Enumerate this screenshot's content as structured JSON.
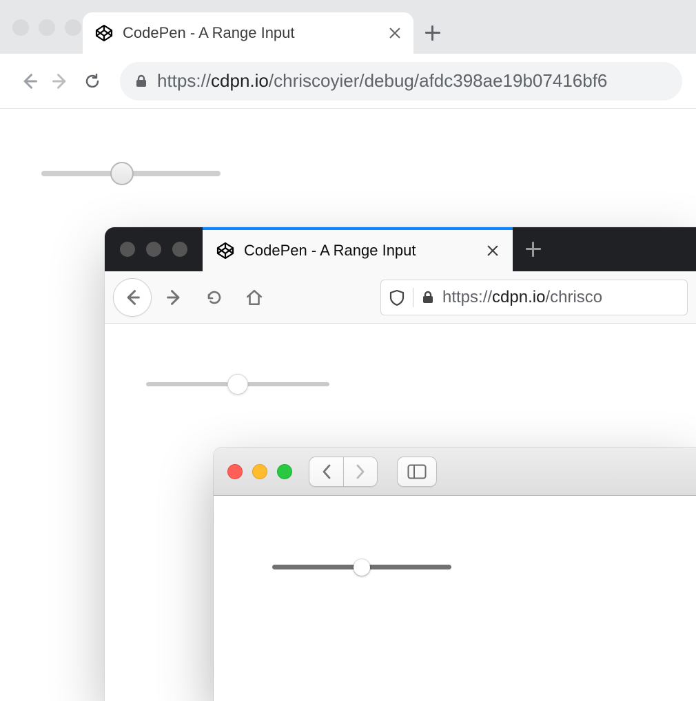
{
  "chrome": {
    "tab_title": "CodePen - A Range Input",
    "url_scheme": "https://",
    "url_host": "cdpn.io",
    "url_path": "/chriscoyier/debug/afdc398ae19b07416bf6",
    "range": {
      "value": 45,
      "min": 0,
      "max": 100
    }
  },
  "firefox": {
    "tab_title": "CodePen - A Range Input",
    "url_scheme": "https://",
    "url_host": "cdpn.io",
    "url_path": "/chrisco",
    "range": {
      "value": 50,
      "min": 0,
      "max": 100
    }
  },
  "safari": {
    "range": {
      "value": 50,
      "min": 0,
      "max": 100
    }
  },
  "accent_firefox_tab": "#0a84ff",
  "safari_traffic": {
    "red": "#ff5f57",
    "yellow": "#febc2e",
    "green": "#28c840"
  }
}
